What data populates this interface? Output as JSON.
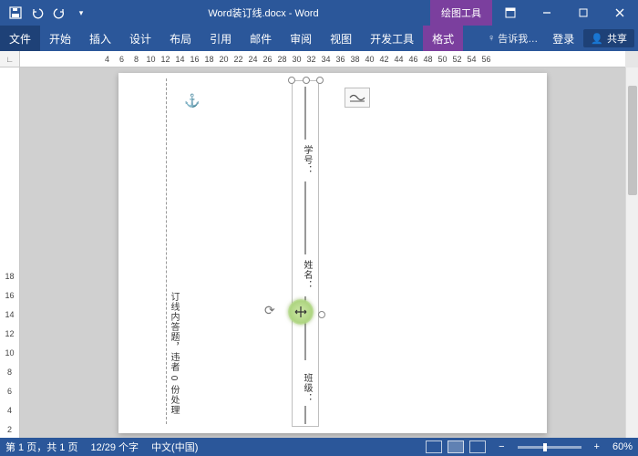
{
  "title": {
    "document": "Word装订线.docx - Word",
    "context_tab": "绘图工具"
  },
  "qat": {
    "save": "保存",
    "undo": "撤消",
    "redo": "恢复"
  },
  "window": {
    "ribbon_opts": "功能区显示选项",
    "min": "最小化",
    "restore": "向下还原",
    "close": "关闭"
  },
  "tabs": {
    "file": "文件",
    "home": "开始",
    "insert": "插入",
    "design": "设计",
    "layout": "布局",
    "references": "引用",
    "mailings": "邮件",
    "review": "审阅",
    "view": "视图",
    "developer": "开发工具",
    "format": "格式"
  },
  "ribbon_right": {
    "tell_me": "告诉我…",
    "login": "登录",
    "share": "共享"
  },
  "ruler": {
    "h": [
      "4",
      "6",
      "8",
      "10",
      "12",
      "14",
      "16",
      "18",
      "20",
      "22",
      "24",
      "26",
      "28",
      "30",
      "32",
      "34",
      "36",
      "38",
      "40",
      "42",
      "44",
      "46",
      "48",
      "50",
      "52",
      "54",
      "56"
    ],
    "v": [
      "2",
      "4",
      "6",
      "8",
      "10",
      "12",
      "14",
      "16",
      "18"
    ]
  },
  "doc": {
    "anchor": "⚓",
    "binding_note": "订线内答题，违者 0 份处理",
    "fields": {
      "xuehao": "学号：",
      "xingming": "姓名：",
      "banji": "班级："
    }
  },
  "status": {
    "page": "第 1 页，共 1 页",
    "words": "12/29 个字",
    "lang": "中文(中国)",
    "zoom": "60%",
    "zoom_out": "−",
    "zoom_in": "+"
  }
}
